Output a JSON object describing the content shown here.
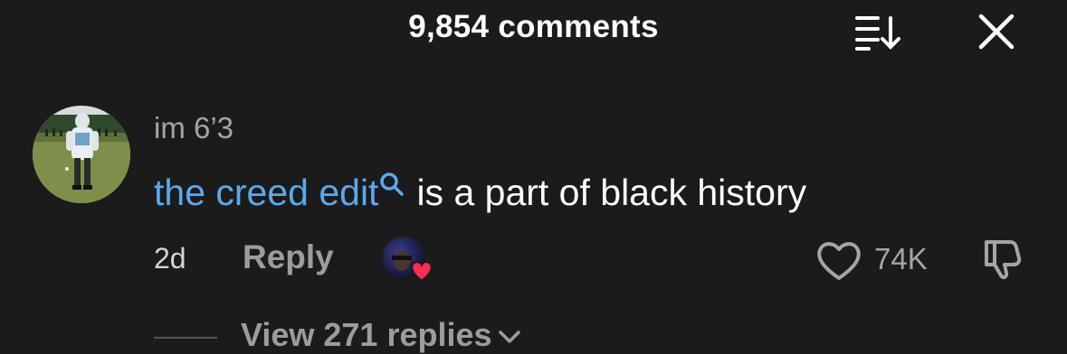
{
  "header": {
    "title": "9,854 comments",
    "sort_icon": "sort-down-icon",
    "close_icon": "close-icon"
  },
  "comment": {
    "username": "im 6’3",
    "tag_text": "the creed edit",
    "body_text": "is a part of black history",
    "age": "2d",
    "reply_label": "Reply",
    "like_count": "74K",
    "creator_liked": true
  },
  "replies": {
    "view_label": "View 271 replies"
  },
  "colors": {
    "background": "#1b1b1b",
    "link": "#5aa9ef",
    "muted": "#a5a5a5",
    "heart_badge": "#fe2c55"
  }
}
